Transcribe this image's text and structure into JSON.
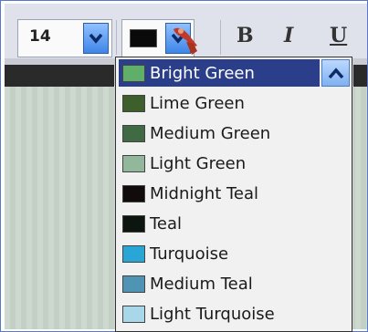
{
  "toolbar": {
    "font_size": "14",
    "bold_label": "B",
    "italic_label": "I",
    "underline_label": "U",
    "selected_color": "#0a0a0a"
  },
  "dropdown": {
    "items": [
      {
        "label": "Bright Green",
        "color": "#5fae6a",
        "selected": true
      },
      {
        "label": "Lime Green",
        "color": "#3d5f2c"
      },
      {
        "label": "Medium Green",
        "color": "#3f6a43"
      },
      {
        "label": "Light Green",
        "color": "#93b79a"
      },
      {
        "label": "Midnight Teal",
        "color": "#120b0c"
      },
      {
        "label": "Teal",
        "color": "#0c160f"
      },
      {
        "label": "Turquoise",
        "color": "#2aa6d6"
      },
      {
        "label": "Medium Teal",
        "color": "#4f93b5"
      },
      {
        "label": "Light Turquoise",
        "color": "#a8d7ea"
      }
    ]
  }
}
